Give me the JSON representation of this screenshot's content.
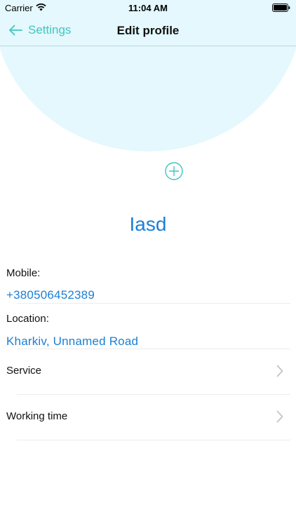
{
  "status_bar": {
    "carrier": "Carrier",
    "time": "11:04 AM"
  },
  "nav": {
    "back_label": "Settings",
    "title": "Edit profile"
  },
  "profile": {
    "name": "Iasd"
  },
  "fields": {
    "mobile": {
      "label": "Mobile:",
      "value": "+380506452389"
    },
    "location": {
      "label": "Location:",
      "value": "Kharkiv, Unnamed Road"
    }
  },
  "rows": [
    {
      "label": "Service"
    },
    {
      "label": "Working time"
    }
  ],
  "colors": {
    "accent": "#3fc6bf",
    "link_blue": "#1b7fd6",
    "header_bg": "#e4f8fd"
  }
}
